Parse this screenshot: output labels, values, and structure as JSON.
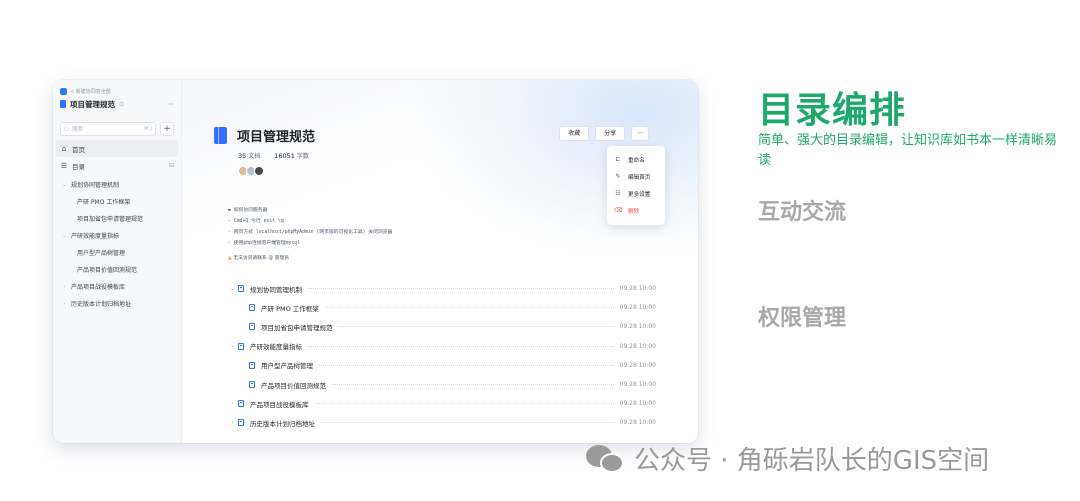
{
  "sidebar": {
    "breadcrumb": "< 新建协同意全部",
    "title": "项目管理规范",
    "search_placeholder": "搜索",
    "search_shortcut": "⌘ J",
    "nav": [
      {
        "label": "首页"
      },
      {
        "label": "目录"
      }
    ],
    "tree": [
      {
        "label": "规划协同管理机制",
        "level": 0,
        "caret": "⌄"
      },
      {
        "label": "产研 PMO 工作框架",
        "level": 1,
        "caret": ""
      },
      {
        "label": "项目加省包申请管理规范",
        "level": 1,
        "caret": ""
      },
      {
        "label": "产研效能度量指标",
        "level": 0,
        "caret": "⌄"
      },
      {
        "label": "用户型产品树管理",
        "level": 1,
        "caret": ""
      },
      {
        "label": "产品项目价值回测规范",
        "level": 1,
        "caret": ""
      },
      {
        "label": "产品项目战役模板库",
        "level": 0,
        "caret": "›"
      },
      {
        "label": "历史版本计划归档地址",
        "level": 0,
        "caret": "›"
      }
    ]
  },
  "doc": {
    "title": "项目管理规范",
    "docs_count": "35",
    "docs_label": "文档",
    "words_count": "16051",
    "words_label": "字数",
    "buttons": {
      "collect": "收藏",
      "share": "分享",
      "more": "···"
    },
    "notes": [
      "如何访问服务器",
      "-  Cmd+Q 今行 exit \\q",
      "-  网页方式 localhost/phpMyAdmin (网页版的可视化工具) 关闭浏览器",
      "-  使用php连接客户端管理mysql"
    ],
    "warn": "无法访问请联系 @ 管理员"
  },
  "menu": {
    "items": [
      {
        "label": "重命名",
        "icon": "rename-icon",
        "danger": false
      },
      {
        "label": "编辑首页",
        "icon": "edit-icon",
        "danger": false
      },
      {
        "label": "更多设置",
        "icon": "settings-icon",
        "danger": false
      },
      {
        "label": "删除",
        "icon": "delete-icon",
        "danger": true
      }
    ]
  },
  "toc": [
    {
      "label": "规划协同管理机制",
      "level": 0,
      "time": "09.28 10:00"
    },
    {
      "label": "产研 PMO 工作框架",
      "level": 1,
      "time": "09.28 10:00"
    },
    {
      "label": "项目加省包申请管理规范",
      "level": 1,
      "time": "09.28 10:00"
    },
    {
      "label": "产研效能度量指标",
      "level": 0,
      "time": "09.28 10:00"
    },
    {
      "label": "用户型产品树管理",
      "level": 1,
      "time": "09.28 10:00"
    },
    {
      "label": "产品项目价值回测规范",
      "level": 1,
      "time": "09.28 10:00"
    },
    {
      "label": "产品项目战役模板库",
      "level": 0,
      "time": "09.28 10:00"
    },
    {
      "label": "历史版本计划归档地址",
      "level": 0,
      "time": "09.28 10:00"
    }
  ],
  "features": {
    "title": "目录编排",
    "desc": "简单、强大的目录编辑，让知识库如书本一样清晰易读",
    "item2": "互动交流",
    "item3": "权限管理"
  },
  "watermark": "公众号 · 角砾岩队长的GIS空间",
  "colors": {
    "accent_green": "#1fa86b",
    "brand_blue": "#3370ff",
    "danger": "#f54a45",
    "muted": "#a8a8a8"
  }
}
